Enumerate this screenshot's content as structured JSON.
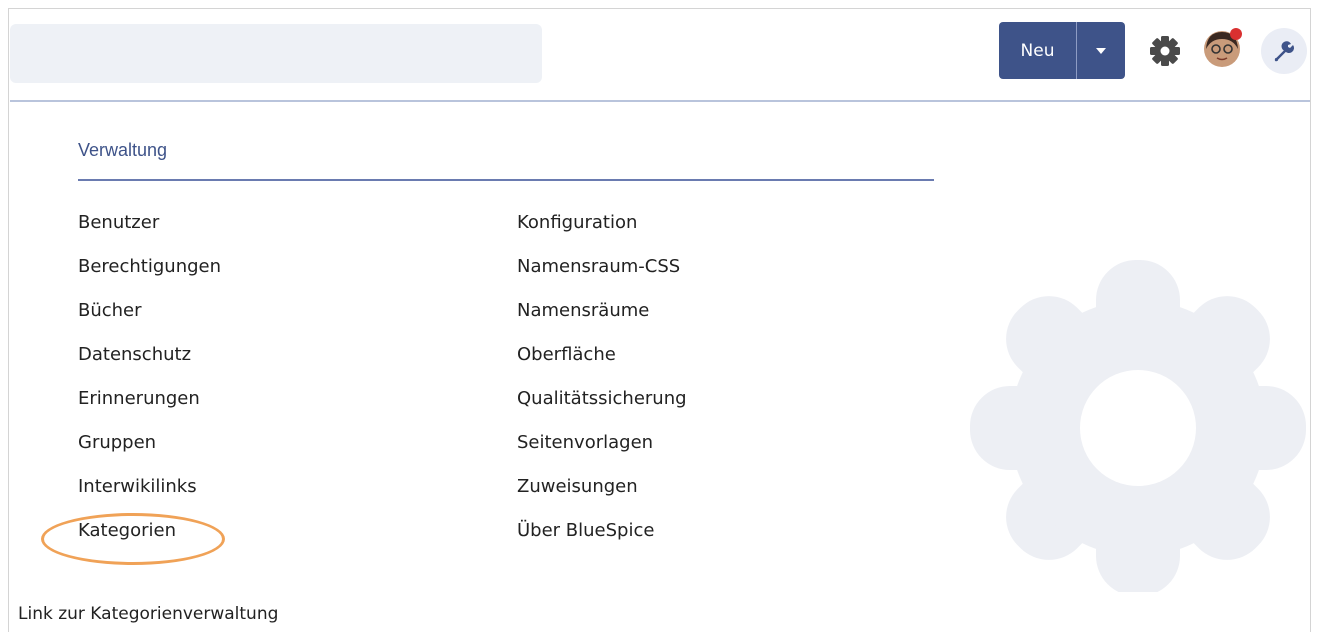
{
  "header": {
    "search_placeholder": "",
    "new_button_label": "Neu",
    "new_button_color": "#3e5389"
  },
  "icons": {
    "settings": "gear-icon",
    "user": "avatar",
    "tools": "wrench-icon"
  },
  "panel": {
    "title": "Verwaltung",
    "column1": [
      "Benutzer",
      "Berechtigungen",
      "Bücher",
      "Datenschutz",
      "Erinnerungen",
      "Gruppen",
      "Interwikilinks",
      "Kategorien"
    ],
    "column2": [
      "Konfiguration",
      "Namensraum-CSS",
      "Namensräume",
      "Oberfläche",
      "Qualitätssicherung",
      "Seitenvorlagen",
      "Zuweisungen",
      "Über BlueSpice"
    ],
    "highlighted_item": "Kategorien",
    "highlight_color": "#f0a257"
  },
  "caption": "Link zur Kategorienverwaltung"
}
